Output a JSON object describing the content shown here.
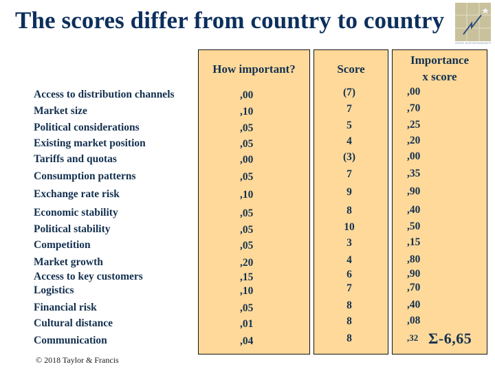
{
  "slide": {
    "title": "The scores differ from country to country",
    "logo_caption": "NORSK EKSPORTBAROMETER",
    "copyright": "© 2018 Taylor & Francis"
  },
  "table": {
    "headers": {
      "importance": "How important?",
      "score": "Score",
      "product_line1": "Importance",
      "product_line2": "x score"
    },
    "rows": [
      {
        "factor": "Access to distribution channels",
        "importance": ",00",
        "score": "(7)",
        "product": ",00"
      },
      {
        "factor": "Market size",
        "importance": ",10",
        "score": "7",
        "product": ",70"
      },
      {
        "factor": "Political considerations",
        "importance": ",05",
        "score": "5",
        "product": ",25"
      },
      {
        "factor": "Existing market position",
        "importance": ",05",
        "score": "4",
        "product": ",20"
      },
      {
        "factor": "Tariffs and quotas",
        "importance": ",00",
        "score": "(3)",
        "product": ",00"
      },
      {
        "factor": "Consumption patterns",
        "importance": ",05",
        "score": "7",
        "product": ",35"
      },
      {
        "factor": "Exchange rate risk",
        "importance": ",10",
        "score": "9",
        "product": ",90"
      },
      {
        "factor": "Economic stability",
        "importance": ",05",
        "score": "8",
        "product": ",40"
      },
      {
        "factor": "Political stability",
        "importance": ",05",
        "score": "10",
        "product": ",50"
      },
      {
        "factor": "Competition",
        "importance": ",05",
        "score": "3",
        "product": ",15"
      },
      {
        "factor": "Market growth",
        "importance": ",20",
        "score": "4",
        "product": ",80"
      },
      {
        "factor": "Access to key customers",
        "importance": ",15",
        "score": "6",
        "product": ",90"
      },
      {
        "factor": "Logistics",
        "importance": ",10",
        "score": "7",
        "product": ",70"
      },
      {
        "factor": "Financial risk",
        "importance": ",05",
        "score": "8",
        "product": ",40"
      },
      {
        "factor": "Cultural distance",
        "importance": ",01",
        "score": "8",
        "product": ",08"
      },
      {
        "factor": "Communication",
        "importance": ",04",
        "score": "8",
        "product": ",32"
      }
    ],
    "total": "Σ-6,65"
  },
  "colors": {
    "title": "#0c2f5c",
    "text": "#13304f",
    "box_fill": "#fed99a",
    "box_border": "#111111"
  }
}
